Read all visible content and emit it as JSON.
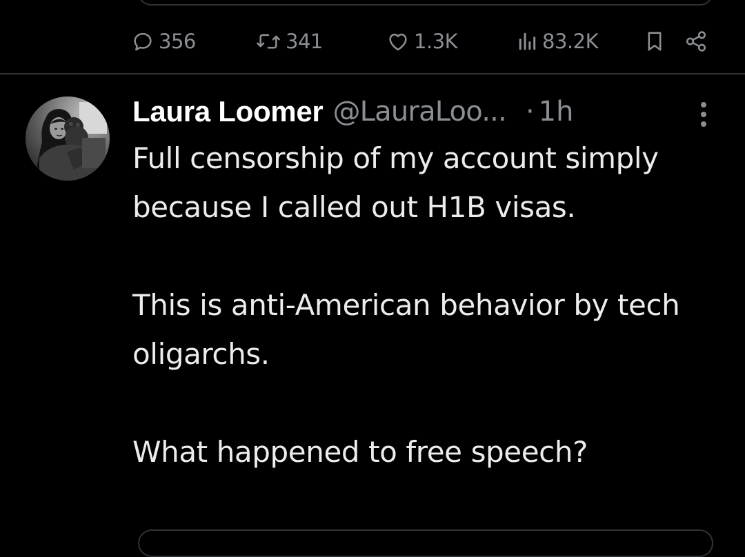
{
  "previous_post": {
    "actions": {
      "replies": "356",
      "reposts": "341",
      "likes": "1.3K",
      "views": "83.2K"
    },
    "icons": [
      "reply-icon",
      "repost-icon",
      "like-icon",
      "views-icon",
      "bookmark-icon",
      "share-icon"
    ]
  },
  "post": {
    "author_name": "Laura Loomer",
    "author_handle": "@LauraLoo...",
    "separator": "·",
    "time": "1h",
    "text": "Full censorship of my account simply because I called out H1B visas.\n\nThis is anti-American behavior by tech oligarchs.\n\nWhat happened to free speech?"
  },
  "colors": {
    "background": "#000000",
    "text": "#e7e9ea",
    "muted": "#8b8f94",
    "divider": "#2f3336"
  }
}
